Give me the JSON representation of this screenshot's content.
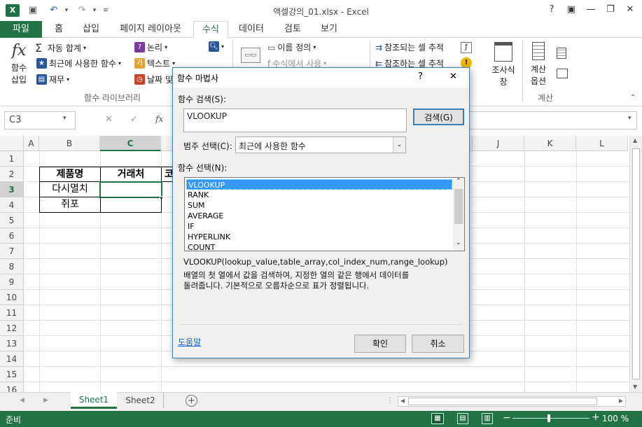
{
  "titlebar": {
    "title": "액셀강의_01.xlsx - Excel",
    "help": "?",
    "minimize": "—",
    "restore": "❐",
    "close": "✕"
  },
  "tabs": {
    "file": "파일",
    "items": [
      "홈",
      "삽입",
      "페이지 레이아웃",
      "수식",
      "데이터",
      "검토",
      "보기"
    ]
  },
  "ribbon": {
    "insert_function": "함수\n삽입",
    "insert_function_l1": "함수",
    "insert_function_l2": "삽입",
    "autosum": "자동 합계",
    "recent": "최근에 사용한 함수",
    "financial": "재무",
    "logical": "논리",
    "text": "텍스트",
    "datetime": "날짜 및",
    "group_library": "함수 라이브러리",
    "define_name": "이름 정의",
    "use_in_formula": "수식에서 사용",
    "trace_precedents": "참조되는 셀 추적",
    "trace_dependents": "참조하는 셀 추적",
    "watch_l1": "조사식",
    "watch_l2": "창",
    "calc_l1": "계산",
    "calc_l2": "옵션",
    "group_calc": "계산"
  },
  "formulabar": {
    "namebox": "C3",
    "fx": "fx"
  },
  "grid": {
    "columns": [
      "A",
      "B",
      "C",
      "",
      "",
      "",
      "",
      "",
      "",
      "J",
      "K",
      "L"
    ],
    "rows": [
      "1",
      "2",
      "3",
      "4",
      "5",
      "6",
      "7",
      "8",
      "9",
      "10",
      "11",
      "12",
      "13",
      "14",
      "15",
      "16"
    ],
    "cells": {
      "B2": "제품명",
      "C2": "거래처",
      "D2": "코",
      "B3": "다시멸치",
      "B4": "쥐포"
    }
  },
  "sheets": {
    "tabs": [
      "Sheet1",
      "Sheet2"
    ],
    "active": "Sheet1"
  },
  "status": {
    "ready": "준비",
    "zoom": "100 %"
  },
  "dialog": {
    "title": "함수 마법사",
    "help": "?",
    "close": "✕",
    "search_label": "함수 검색(S):",
    "search_value": "VLOOKUP",
    "search_button": "검색(G)",
    "category_label": "범주 선택(C):",
    "category_value": "최근에 사용한 함수",
    "select_label": "함수 선택(N):",
    "functions": [
      "VLOOKUP",
      "RANK",
      "SUM",
      "AVERAGE",
      "IF",
      "HYPERLINK",
      "COUNT"
    ],
    "selected_function": "VLOOKUP",
    "signature": "VLOOKUP(lookup_value,table_array,col_index_num,range_lookup)",
    "description_1": "배열의 첫 열에서 값을 검색하여, 지정한 열의 같은 행에서 데이터를",
    "description_2": "돌려줍니다. 기본적으로 오름차순으로 표가 정렬됩니다.",
    "help_link": "도움말",
    "ok": "확인",
    "cancel": "취소"
  },
  "colors": {
    "excel_green": "#217346",
    "selection_blue": "#3399ff"
  }
}
